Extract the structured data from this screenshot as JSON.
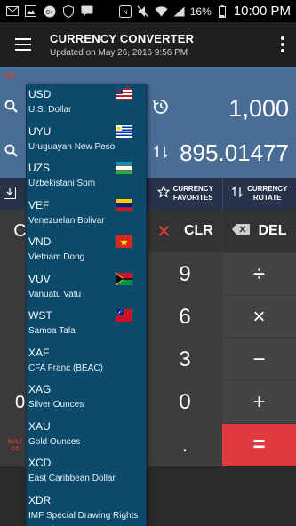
{
  "status_bar": {
    "battery_percent": "16%",
    "time": "10:00 PM",
    "icons": [
      "email-icon",
      "image-icon",
      "messenger-icon",
      "shield-icon",
      "chat-icon",
      "nfc-icon",
      "mute-icon",
      "wifi-icon",
      "signal-icon",
      "battery-icon"
    ]
  },
  "appbar": {
    "title": "CURRENCY CONVERTER",
    "subtitle": "Updated on May 26, 2016 9:56 PM",
    "menu_icon": "hamburger-icon",
    "overflow_icon": "more-vert-icon"
  },
  "converter": {
    "lang_badge": "EN",
    "from_value": "1,000",
    "to_value": "895.01477",
    "history_icon": "history-icon",
    "swap_icon": "swap-icon",
    "search_icon": "search-icon"
  },
  "function_row": {
    "favorites_label_1": "CURRENCY",
    "favorites_label_2": "FAVORITES",
    "rotate_label_1": "CURRENCY",
    "rotate_label_2": "ROTATE"
  },
  "keypad": {
    "clr": "CLR",
    "del": "DEL",
    "k9": "9",
    "k6": "6",
    "k3": "3",
    "k0": "0",
    "dot": ".",
    "divide": "÷",
    "multiply": "×",
    "minus": "−",
    "plus": "+",
    "equals": "=",
    "left_c": "C",
    "left_0": "0",
    "mult_label_1": "MULT",
    "mult_label_2": "CO"
  },
  "currency_list": [
    {
      "code": "USD",
      "name": "U.S. Dollar",
      "flag": "us-flag"
    },
    {
      "code": "UYU",
      "name": "Uruguayan New Peso",
      "flag": "uruguay-flag"
    },
    {
      "code": "UZS",
      "name": "Uzbekistani Som",
      "flag": "uzbekistan-flag"
    },
    {
      "code": "VEF",
      "name": "Venezuelan Bolivar",
      "flag": "venezuela-flag"
    },
    {
      "code": "VND",
      "name": "Vietnam Dong",
      "flag": "vietnam-flag"
    },
    {
      "code": "VUV",
      "name": "Vanuatu Vatu",
      "flag": "vanuatu-flag"
    },
    {
      "code": "WST",
      "name": "Samoa Tala",
      "flag": "samoa-flag"
    },
    {
      "code": "XAF",
      "name": "CFA Franc (BEAC)",
      "flag": ""
    },
    {
      "code": "XAG",
      "name": "Silver Ounces",
      "flag": ""
    },
    {
      "code": "XAU",
      "name": "Gold Ounces",
      "flag": ""
    },
    {
      "code": "XCD",
      "name": "East Caribbean Dollar",
      "flag": ""
    },
    {
      "code": "XDR",
      "name": "IMF Special Drawing Rights",
      "flag": ""
    }
  ],
  "colors": {
    "converter_bg": "#4a6d96",
    "dropdown_bg": "#0b4a6b",
    "equals_red": "#e03a3e",
    "clear_x_red": "#e53935"
  }
}
